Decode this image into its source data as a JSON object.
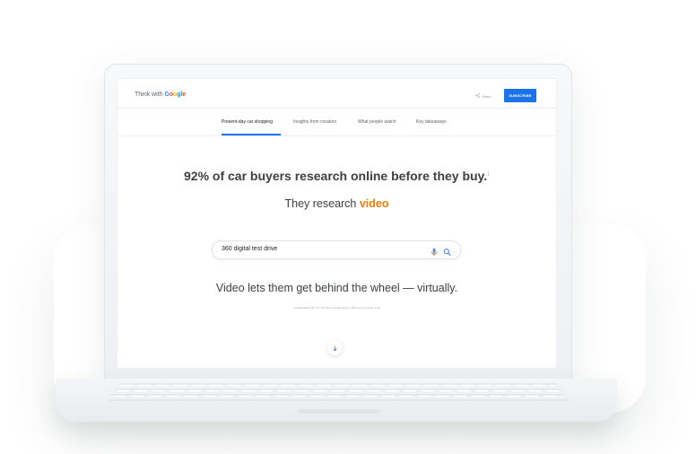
{
  "header": {
    "logo_prefix": "Think with ",
    "logo_google": [
      "G",
      "o",
      "o",
      "g",
      "l",
      "e"
    ],
    "logo_colors": [
      "#4285F4",
      "#EA4335",
      "#FBBC05",
      "#4285F4",
      "#34A853",
      "#EA4335"
    ],
    "share_label": "Share",
    "share_icon": "share-icon",
    "subscribe_label": "SUBSCRIBE"
  },
  "tabs": [
    {
      "label": "Present-day car shopping",
      "active": true
    },
    {
      "label": "Insights from creators",
      "active": false
    },
    {
      "label": "What people watch",
      "active": false
    },
    {
      "label": "Key takeaways",
      "active": false
    }
  ],
  "main": {
    "headline": "92% of car buyers research online before they buy.",
    "headline_sup": "1",
    "sub_prefix": "They research ",
    "sub_highlight": "video",
    "search_value": "360 digital test drive",
    "mic_icon": "microphone-icon",
    "search_icon": "search-icon",
    "statement": "Video lets them get behind the wheel — virtually.",
    "footnote": "¹ Google/Kantar TNS, U.S., The Drive to Decide Survey, n=500 recent car buyers, 2018.",
    "scroll_icon": "arrow-down-icon"
  },
  "colors": {
    "accent": "#1a73e8",
    "highlight": "#f57c00",
    "text": "#3c4043"
  }
}
